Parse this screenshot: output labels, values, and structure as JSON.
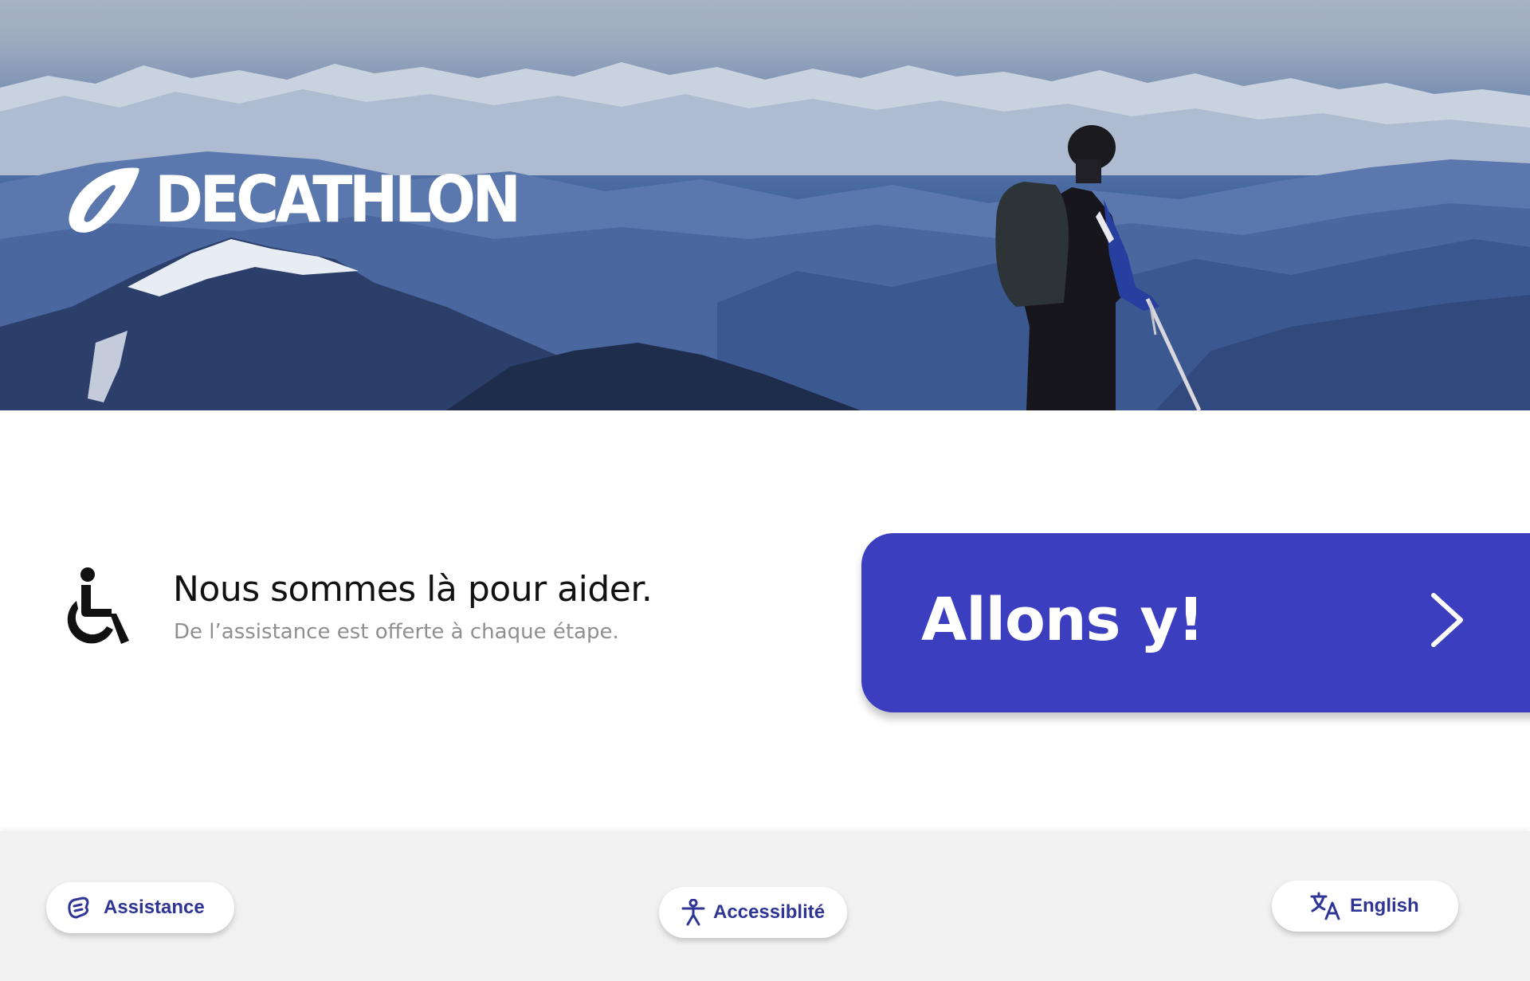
{
  "brand": {
    "name": "DECATHLON",
    "primary_color": "#3b3fbf",
    "text_accent_color": "#2f3595"
  },
  "hero": {
    "image": "snowy mountain range with hiker holding ski poles"
  },
  "help": {
    "icon": "wheelchair-icon",
    "title": "Nous sommes là pour aider.",
    "subtitle": "De l’assistance est offerte à chaque étape."
  },
  "cta": {
    "label": "Allons y!",
    "icon": "chevron-right-icon"
  },
  "footer": {
    "assistance": {
      "label": "Assistance",
      "icon": "hand-help-icon"
    },
    "accessibility": {
      "label": "Accessiblité",
      "icon": "accessibility-person-icon"
    },
    "language": {
      "label": "English",
      "icon": "translate-icon"
    }
  }
}
